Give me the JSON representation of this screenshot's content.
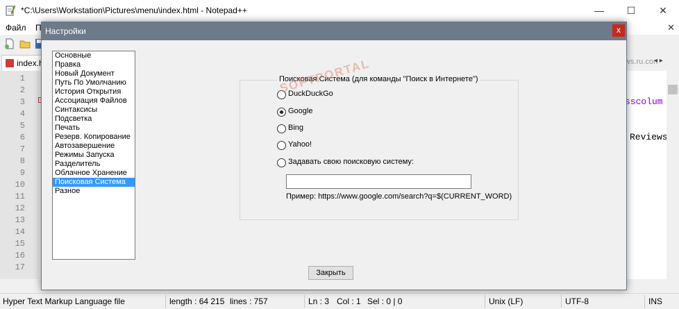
{
  "window": {
    "title": "*C:\\Users\\Workstation\\Pictures\\menu\\index.html - Notepad++",
    "minimize_glyph": "—",
    "maximize_glyph": "☐",
    "close_glyph": "✕"
  },
  "menubar": {
    "items": [
      "Файл",
      "П"
    ],
    "close_glyph": "✕"
  },
  "toolbar": {
    "icons": [
      "new-file-icon",
      "open-file-icon",
      "save-file-icon"
    ]
  },
  "tabs": {
    "active_label": "index.ht",
    "right_label": "ws.ru.con",
    "arrows": "◂ ▸"
  },
  "editor": {
    "line_numbers": [
      "1",
      "2",
      "3",
      "4",
      "5",
      "6",
      "7",
      "8",
      "9",
      "10",
      "11",
      "12",
      "13",
      "14",
      "15",
      "16",
      "17"
    ],
    "visible_code": {
      "line3": "sscolum",
      "line6": "Reviews"
    },
    "colors": {
      "keyword": "#8000ff"
    }
  },
  "statusbar": {
    "file_type": "Hyper Text Markup Language file",
    "length": "length : 64 215",
    "lines": "lines : 757",
    "ln": "Ln : 3",
    "col": "Col : 1",
    "sel": "Sel : 0 | 0",
    "eol": "Unix (LF)",
    "encoding": "UTF-8",
    "mode": "INS"
  },
  "dialog": {
    "title": "Настройки",
    "close_glyph": "x",
    "categories": [
      "Основные",
      "Правка",
      "Новый Документ",
      "Путь По Умолчанию",
      "История Открытия",
      "Ассоциация Файлов",
      "Синтаксисы",
      "Подсветка",
      "Печать",
      "Резерв. Копирование",
      "Автозавершение",
      "Режимы Запуска",
      "Разделитель",
      "Облачное Хранение",
      "Поисковая Система",
      "Разное"
    ],
    "selected_category": "Поисковая Система",
    "group_title": "Поисковая Система (для команды \"Поиск в Интернете\")",
    "engines": [
      {
        "label": "DuckDuckGo",
        "checked": false
      },
      {
        "label": "Google",
        "checked": true
      },
      {
        "label": "Bing",
        "checked": false
      },
      {
        "label": "Yahoo!",
        "checked": false
      },
      {
        "label": "Задавать свою поисковую систему:",
        "checked": false
      }
    ],
    "custom_url_value": "",
    "example": "Пример: https://www.google.com/search?q=$(CURRENT_WORD)",
    "close_button": "Закрыть",
    "colors": {
      "titlebar": "#6c7a89",
      "selection": "#3399ff",
      "close": "#c42b1c"
    }
  },
  "watermark": "SOFTPORTAL"
}
